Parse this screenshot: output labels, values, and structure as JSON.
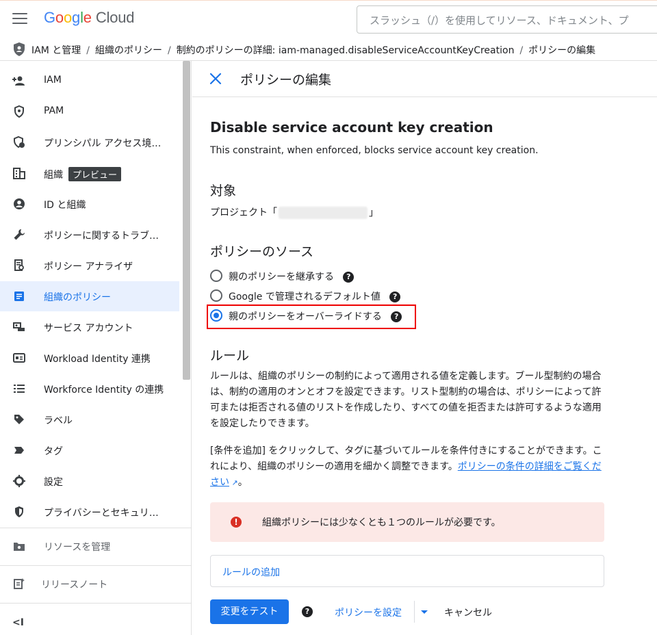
{
  "header": {
    "logo_letters": [
      "G",
      "o",
      "o",
      "g",
      "l",
      "e"
    ],
    "logo_suffix": "Cloud",
    "search_placeholder": "スラッシュ（/）を使用してリソース、ドキュメント、プ"
  },
  "breadcrumb": {
    "items": [
      "IAM と管理",
      "組織のポリシー",
      "制約のポリシーの詳細: iam-managed.disableServiceAccountKeyCreation",
      "ポリシーの編集"
    ],
    "separator": "/"
  },
  "sidebar": {
    "items": [
      {
        "label": "IAM",
        "icon": "person-add-icon"
      },
      {
        "label": "PAM",
        "icon": "shield-icon"
      },
      {
        "label": "プリンシパル アクセス境…",
        "icon": "principal-access-icon"
      },
      {
        "label": "組織",
        "icon": "building-icon",
        "badge": "プレビュー"
      },
      {
        "label": "ID と組織",
        "icon": "account-circle-icon"
      },
      {
        "label": "ポリシーに関するトラブ…",
        "icon": "wrench-icon"
      },
      {
        "label": "ポリシー アナライザ",
        "icon": "analyzer-icon"
      },
      {
        "label": "組織のポリシー",
        "icon": "list-document-icon",
        "active": true
      },
      {
        "label": "サービス アカウント",
        "icon": "service-account-icon"
      },
      {
        "label": "Workload Identity 連携",
        "icon": "id-card-icon"
      },
      {
        "label": "Workforce Identity の連携",
        "icon": "list-icon"
      },
      {
        "label": "ラベル",
        "icon": "label-icon"
      },
      {
        "label": "タグ",
        "icon": "tag-icon"
      },
      {
        "label": "設定",
        "icon": "gear-icon"
      },
      {
        "label": "プライバシーとセキュリ…",
        "icon": "security-shield-icon"
      }
    ],
    "manage_resources": "リソースを管理",
    "release_notes": "リリースノート",
    "collapse": "<I"
  },
  "main": {
    "title": "ポリシーの編集",
    "policy_name": "Disable service account key creation",
    "policy_description": "This constraint, when enforced, blocks service account key creation.",
    "target_heading": "対象",
    "target_prefix": "プロジェクト「",
    "target_suffix": "」",
    "source_heading": "ポリシーのソース",
    "source_options": [
      {
        "label": "親のポリシーを継承する",
        "checked": false
      },
      {
        "label": "Google で管理されるデフォルト値",
        "checked": false
      },
      {
        "label": "親のポリシーをオーバーライドする",
        "checked": true
      }
    ],
    "rules_heading": "ルール",
    "rules_para1": "ルールは、組織のポリシーの制約によって適用される値を定義します。ブール型制約の場合は、制約の適用のオンとオフを設定できます。リスト型制約の場合は、ポリシーによって許可または拒否される値のリストを作成したり、すべての値を拒否または許可するような適用を設定したりできます。",
    "rules_para2": "[条件を追加] をクリックして、タグに基づいてルールを条件付きにすることができます。これにより、組織のポリシーの適用を細かく調整できます。",
    "rules_link": "ポリシーの条件の詳細をご覧ください",
    "error_message": "組織ポリシーには少なくとも１つのルールが必要です。",
    "add_rule": "ルールの追加",
    "test_button": "変更をテスト",
    "set_policy": "ポリシーを設定",
    "cancel": "キャンセル"
  },
  "colors": {
    "accent": "#1a73e8",
    "error": "#d93025",
    "error_bg": "#fce8e6",
    "highlight": "#e00000"
  }
}
